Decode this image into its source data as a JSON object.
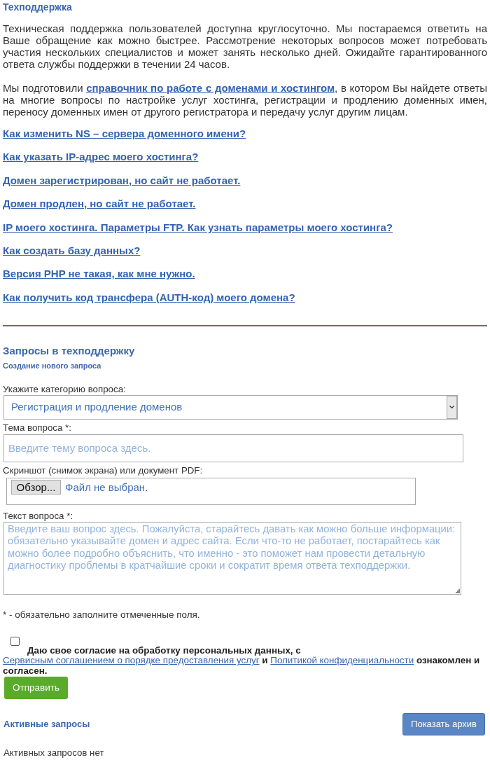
{
  "support": {
    "title": "Техподдержка",
    "intro": "Техническая поддержка пользователей доступна круглосуточно. Мы постараемся ответить на Ваше обращение как можно быстрее. Рассмотрение некоторых вопросов может потребовать участия нескольких специалистов и может занять несколько дней. Ожидайте гарантированного ответа службы поддержки в течении 24 часов.",
    "guide": {
      "before": "Мы подготовили ",
      "link": "справочник по работе с доменами и хостингом",
      "after": ", в котором Вы найдете ответы на многие вопросы по настройке услуг хостинга, регистрации и продлению доменных имен, переносу доменных имен от другого регистратора и передачу услуг другим лицам."
    },
    "faq_links": [
      "Как изменить NS – сервера доменного имени?",
      "Как указать IP-адрес моего хостинга?",
      "Домен зарегистрирован, но сайт не работает.",
      "Домен продлен, но сайт не работает.",
      "IP моего хостинга. Параметры FTP. Как узнать параметры моего хостинга?",
      "Как создать базу данных?",
      "Версия PHP не такая, как мне нужно.",
      "Как получить код трансфера (AUTH-код) моего домена?"
    ]
  },
  "request_form": {
    "title": "Запросы в техподдержку",
    "subtitle": "Создание нового запроса",
    "category": {
      "label": "Укажите категорию вопроса:",
      "value": "Регистрация и продление доменов"
    },
    "subject": {
      "label": "Тема вопроса *:",
      "placeholder": "Введите тему вопроса здесь."
    },
    "attachment": {
      "label": "Скриншот (снимок экрана) или документ PDF:",
      "button": "Обзор...",
      "status": "Файл не выбран."
    },
    "message": {
      "label": "Текст вопроса *:",
      "placeholder": "Введите ваш вопрос здесь. Пожалуйста, старайтесь давать как можно больше информации: обязательно указывайте домен и адрес сайта. Если что-то не работает, постарайтесь как можно более подробно объяснить, что именно - это поможет нам провести детальную диагностику проблемы в кратчайшие сроки и сократит время ответа техподдержки."
    },
    "required_note": "* - обязательно заполните отмеченные поля.",
    "consent": {
      "checked": false,
      "parts": [
        {
          "kind": "text",
          "text": "Даю свое согласие на обработку персональных данных, с "
        },
        {
          "kind": "link",
          "text": "Сервисным соглашением о порядке предоставления услуг"
        },
        {
          "kind": "text",
          "text": " и "
        },
        {
          "kind": "link",
          "text": "Политикой конфиденциальности"
        },
        {
          "kind": "text",
          "text": " ознакомлен и согласен."
        }
      ]
    },
    "submit": "Отправить"
  },
  "active_requests": {
    "title": "Активные запросы",
    "archive_button": "Показать архив",
    "empty": "Активных запросов нет"
  }
}
